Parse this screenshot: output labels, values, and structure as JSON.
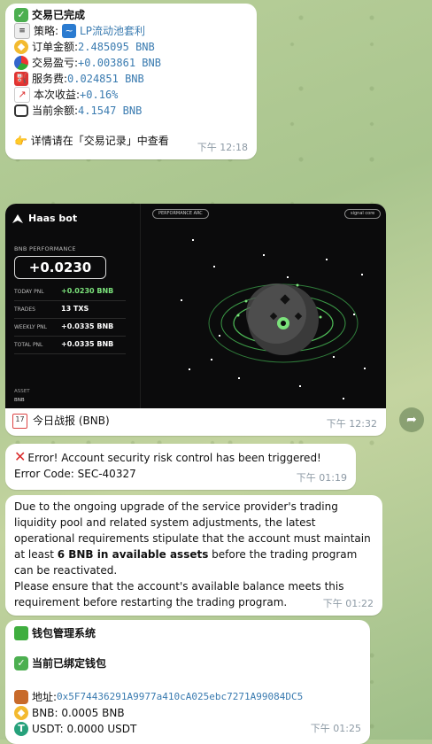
{
  "msg1": {
    "title": "交易已完成",
    "strategy_label": "策略:",
    "strategy_value": "LP流动池套利",
    "order_label": "订单金额:",
    "order_value": "2.485095 BNB",
    "pnl_label": "交易盈亏:",
    "pnl_value": "+0.003861 BNB",
    "fee_label": "服务费:",
    "fee_value": "0.024851 BNB",
    "gain_label": "本次收益:",
    "gain_value": "+0.16%",
    "balance_label": "当前余额:",
    "balance_value": "4.1547 BNB",
    "footer": "👉 详情请在「交易记录」中查看",
    "time": "下午 12:18"
  },
  "msg2": {
    "bot_name": "Haas bot",
    "tag_left": "PERFORMANCE ARC",
    "tag_right": "signal core",
    "perf_label": "BNB PERFORMANCE",
    "pnl_big": "+0.0230",
    "stats": [
      {
        "label": "TODAY PNL",
        "value": "+0.0230 BNB"
      },
      {
        "label": "TRADES",
        "value": "13 TXS"
      },
      {
        "label": "WEEKLY PNL",
        "value": "+0.0335 BNB"
      },
      {
        "label": "TOTAL PNL",
        "value": "+0.0335 BNB"
      }
    ],
    "asset_label": "ASSET",
    "asset_value": "BNB",
    "cal_day": "17",
    "caption": "今日战报 (BNB)",
    "time": "下午 12:32"
  },
  "msg3": {
    "text": "Error! Account security risk control has been triggered! Error Code: SEC-40327",
    "time": "下午 01:19"
  },
  "msg4": {
    "p1_a": "Due to the ongoing upgrade of the service provider's trading liquidity pool and related system adjustments, the latest operational requirements stipulate that the account must maintain at least ",
    "p1_bold": "6 BNB in available assets",
    "p1_b": " before the trading program can be reactivated.",
    "p2": "Please ensure that the account's available balance meets this requirement before restarting the trading program.",
    "time": "下午 01:22"
  },
  "msg5": {
    "title": "钱包管理系统",
    "bound": "当前已绑定钱包",
    "addr_label": "地址:",
    "addr_value": "0x5F74436291A9977a410cA025ebc7271A99084DC5",
    "bnb_label": "BNB:",
    "bnb_value": "0.0005 BNB",
    "usdt_label": "USDT:",
    "usdt_value": "0.0000 USDT",
    "time": "下午 01:25"
  }
}
